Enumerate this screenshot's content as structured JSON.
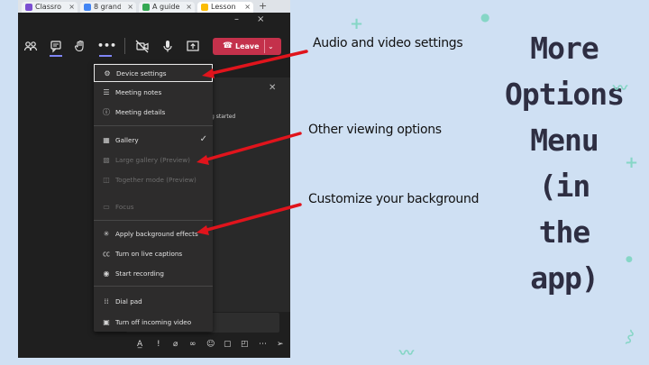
{
  "browser": {
    "tabs": [
      {
        "title": "Classro",
        "favicon_color": "#7b4fd1"
      },
      {
        "title": "8 grand",
        "favicon_color": "#4285f4"
      },
      {
        "title": "A guide",
        "favicon_color": "#34a853"
      },
      {
        "title": "Lesson",
        "favicon_color": "#fbbc04"
      }
    ],
    "new_tab_symbol": "+"
  },
  "teams": {
    "window_controls": [
      "–",
      "×"
    ],
    "leave_label": "Leave",
    "panel_snippet": "g started",
    "menu": {
      "items": [
        {
          "label": "Device settings",
          "icon": "gear-icon",
          "glyph": "⚙",
          "disabled": false
        },
        {
          "label": "Meeting notes",
          "icon": "notes-icon",
          "glyph": "☰",
          "disabled": false
        },
        {
          "label": "Meeting details",
          "icon": "info-icon",
          "glyph": "ⓘ",
          "disabled": false
        },
        {
          "label": "Gallery",
          "icon": "gallery-icon",
          "glyph": "▦",
          "disabled": false,
          "checked": true
        },
        {
          "label": "Large gallery (Preview)",
          "icon": "large-gallery-icon",
          "glyph": "▩",
          "disabled": true
        },
        {
          "label": "Together mode (Preview)",
          "icon": "together-mode-icon",
          "glyph": "◫",
          "disabled": true
        },
        {
          "label": "Focus",
          "icon": "focus-icon",
          "glyph": "▭",
          "disabled": true
        },
        {
          "label": "Apply background effects",
          "icon": "background-effects-icon",
          "glyph": "✳",
          "disabled": false
        },
        {
          "label": "Turn on live captions",
          "icon": "captions-icon",
          "glyph": "㏄",
          "disabled": false
        },
        {
          "label": "Start recording",
          "icon": "record-icon",
          "glyph": "◉",
          "disabled": false
        },
        {
          "label": "Dial pad",
          "icon": "dialpad-icon",
          "glyph": "⁞⁞",
          "disabled": false
        },
        {
          "label": "Turn off incoming video",
          "icon": "video-off-icon",
          "glyph": "▣",
          "disabled": false
        }
      ],
      "check_symbol": "✓"
    }
  },
  "annotations": {
    "audio_video": "Audio and video settings",
    "viewing": "Other viewing options",
    "background": "Customize your background",
    "headline": [
      "More",
      "Options",
      "Menu (in",
      "the app)"
    ],
    "arrow_color": "#e0141c"
  }
}
